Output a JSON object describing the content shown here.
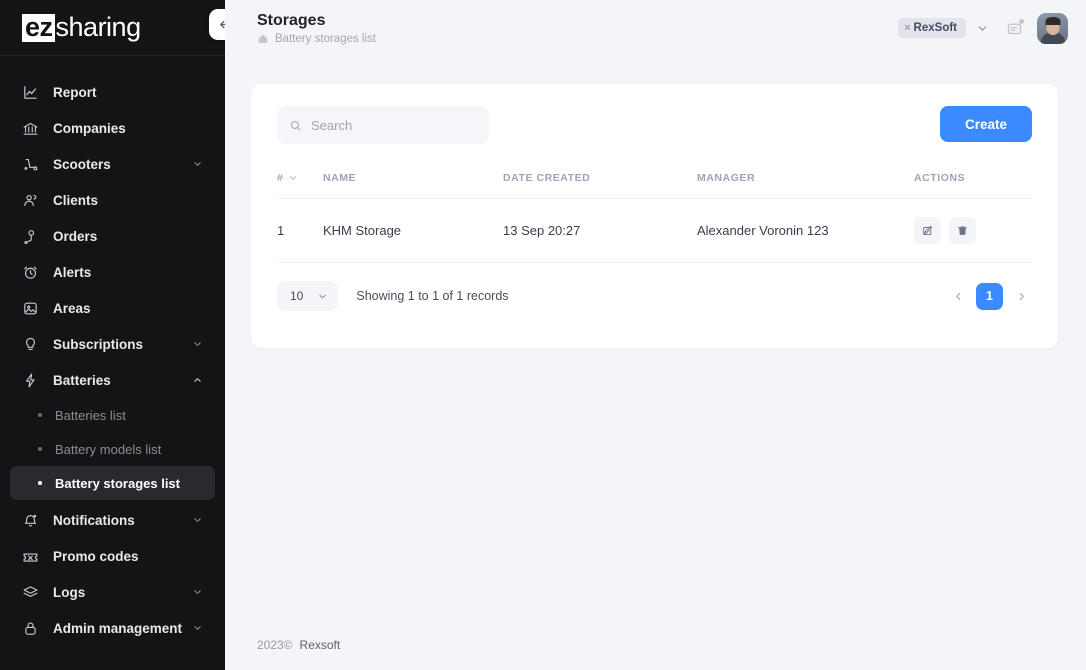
{
  "brand": {
    "logo_primary": "ez",
    "logo_secondary": "sharing",
    "accent": "#3b8aff"
  },
  "sidebar": {
    "collapse_label": "←",
    "items": [
      {
        "label": "Report",
        "icon": "chart-icon",
        "expandable": false
      },
      {
        "label": "Companies",
        "icon": "bank-icon",
        "expandable": false
      },
      {
        "label": "Scooters",
        "icon": "scooter-icon",
        "expandable": true
      },
      {
        "label": "Clients",
        "icon": "users-icon",
        "expandable": false
      },
      {
        "label": "Orders",
        "icon": "pin-icon",
        "expandable": false
      },
      {
        "label": "Alerts",
        "icon": "clock-icon",
        "expandable": false
      },
      {
        "label": "Areas",
        "icon": "image-icon",
        "expandable": false
      },
      {
        "label": "Subscriptions",
        "icon": "bulb-icon",
        "expandable": true
      },
      {
        "label": "Batteries",
        "icon": "bolt-icon",
        "expandable": true,
        "expanded": true
      }
    ],
    "battery_subitems": [
      {
        "label": "Batteries list",
        "active": false
      },
      {
        "label": "Battery models list",
        "active": false
      },
      {
        "label": "Battery storages list",
        "active": true
      }
    ],
    "items_after": [
      {
        "label": "Notifications",
        "icon": "bell-icon",
        "expandable": true
      },
      {
        "label": "Promo codes",
        "icon": "ticket-icon",
        "expandable": false
      },
      {
        "label": "Logs",
        "icon": "layers-icon",
        "expandable": true
      },
      {
        "label": "Admin management",
        "icon": "lock-icon",
        "expandable": true
      }
    ]
  },
  "header": {
    "title": "Storages",
    "breadcrumb": "Battery storages list",
    "breadcrumb_icon": "home-icon",
    "company_chip": "RexSoft",
    "company_chip_remove": "×",
    "messages_icon": "message-icon",
    "avatar": "user-avatar"
  },
  "toolbar": {
    "search_placeholder": "Search",
    "search_value": "",
    "search_icon": "search-icon",
    "create_label": "Create"
  },
  "table": {
    "columns": [
      {
        "key": "idx",
        "label": "#",
        "sortable": true
      },
      {
        "key": "name",
        "label": "NAME",
        "sortable": false
      },
      {
        "key": "date",
        "label": "DATE CREATED",
        "sortable": false
      },
      {
        "key": "manager",
        "label": "MANAGER",
        "sortable": false
      },
      {
        "key": "actions",
        "label": "ACTIONS",
        "sortable": false
      }
    ],
    "rows": [
      {
        "idx": "1",
        "name": "KHM Storage",
        "date": "13 Sep 20:27",
        "manager": "Alexander Voronin 123",
        "edit_icon": "edit-icon",
        "delete_icon": "trash-icon"
      }
    ]
  },
  "pagination": {
    "per_page": "10",
    "showing": "Showing 1 to 1 of 1 records",
    "prev": "‹",
    "next": "›",
    "current_page": "1"
  },
  "footer": {
    "year": "2023©",
    "company": "Rexsoft"
  }
}
